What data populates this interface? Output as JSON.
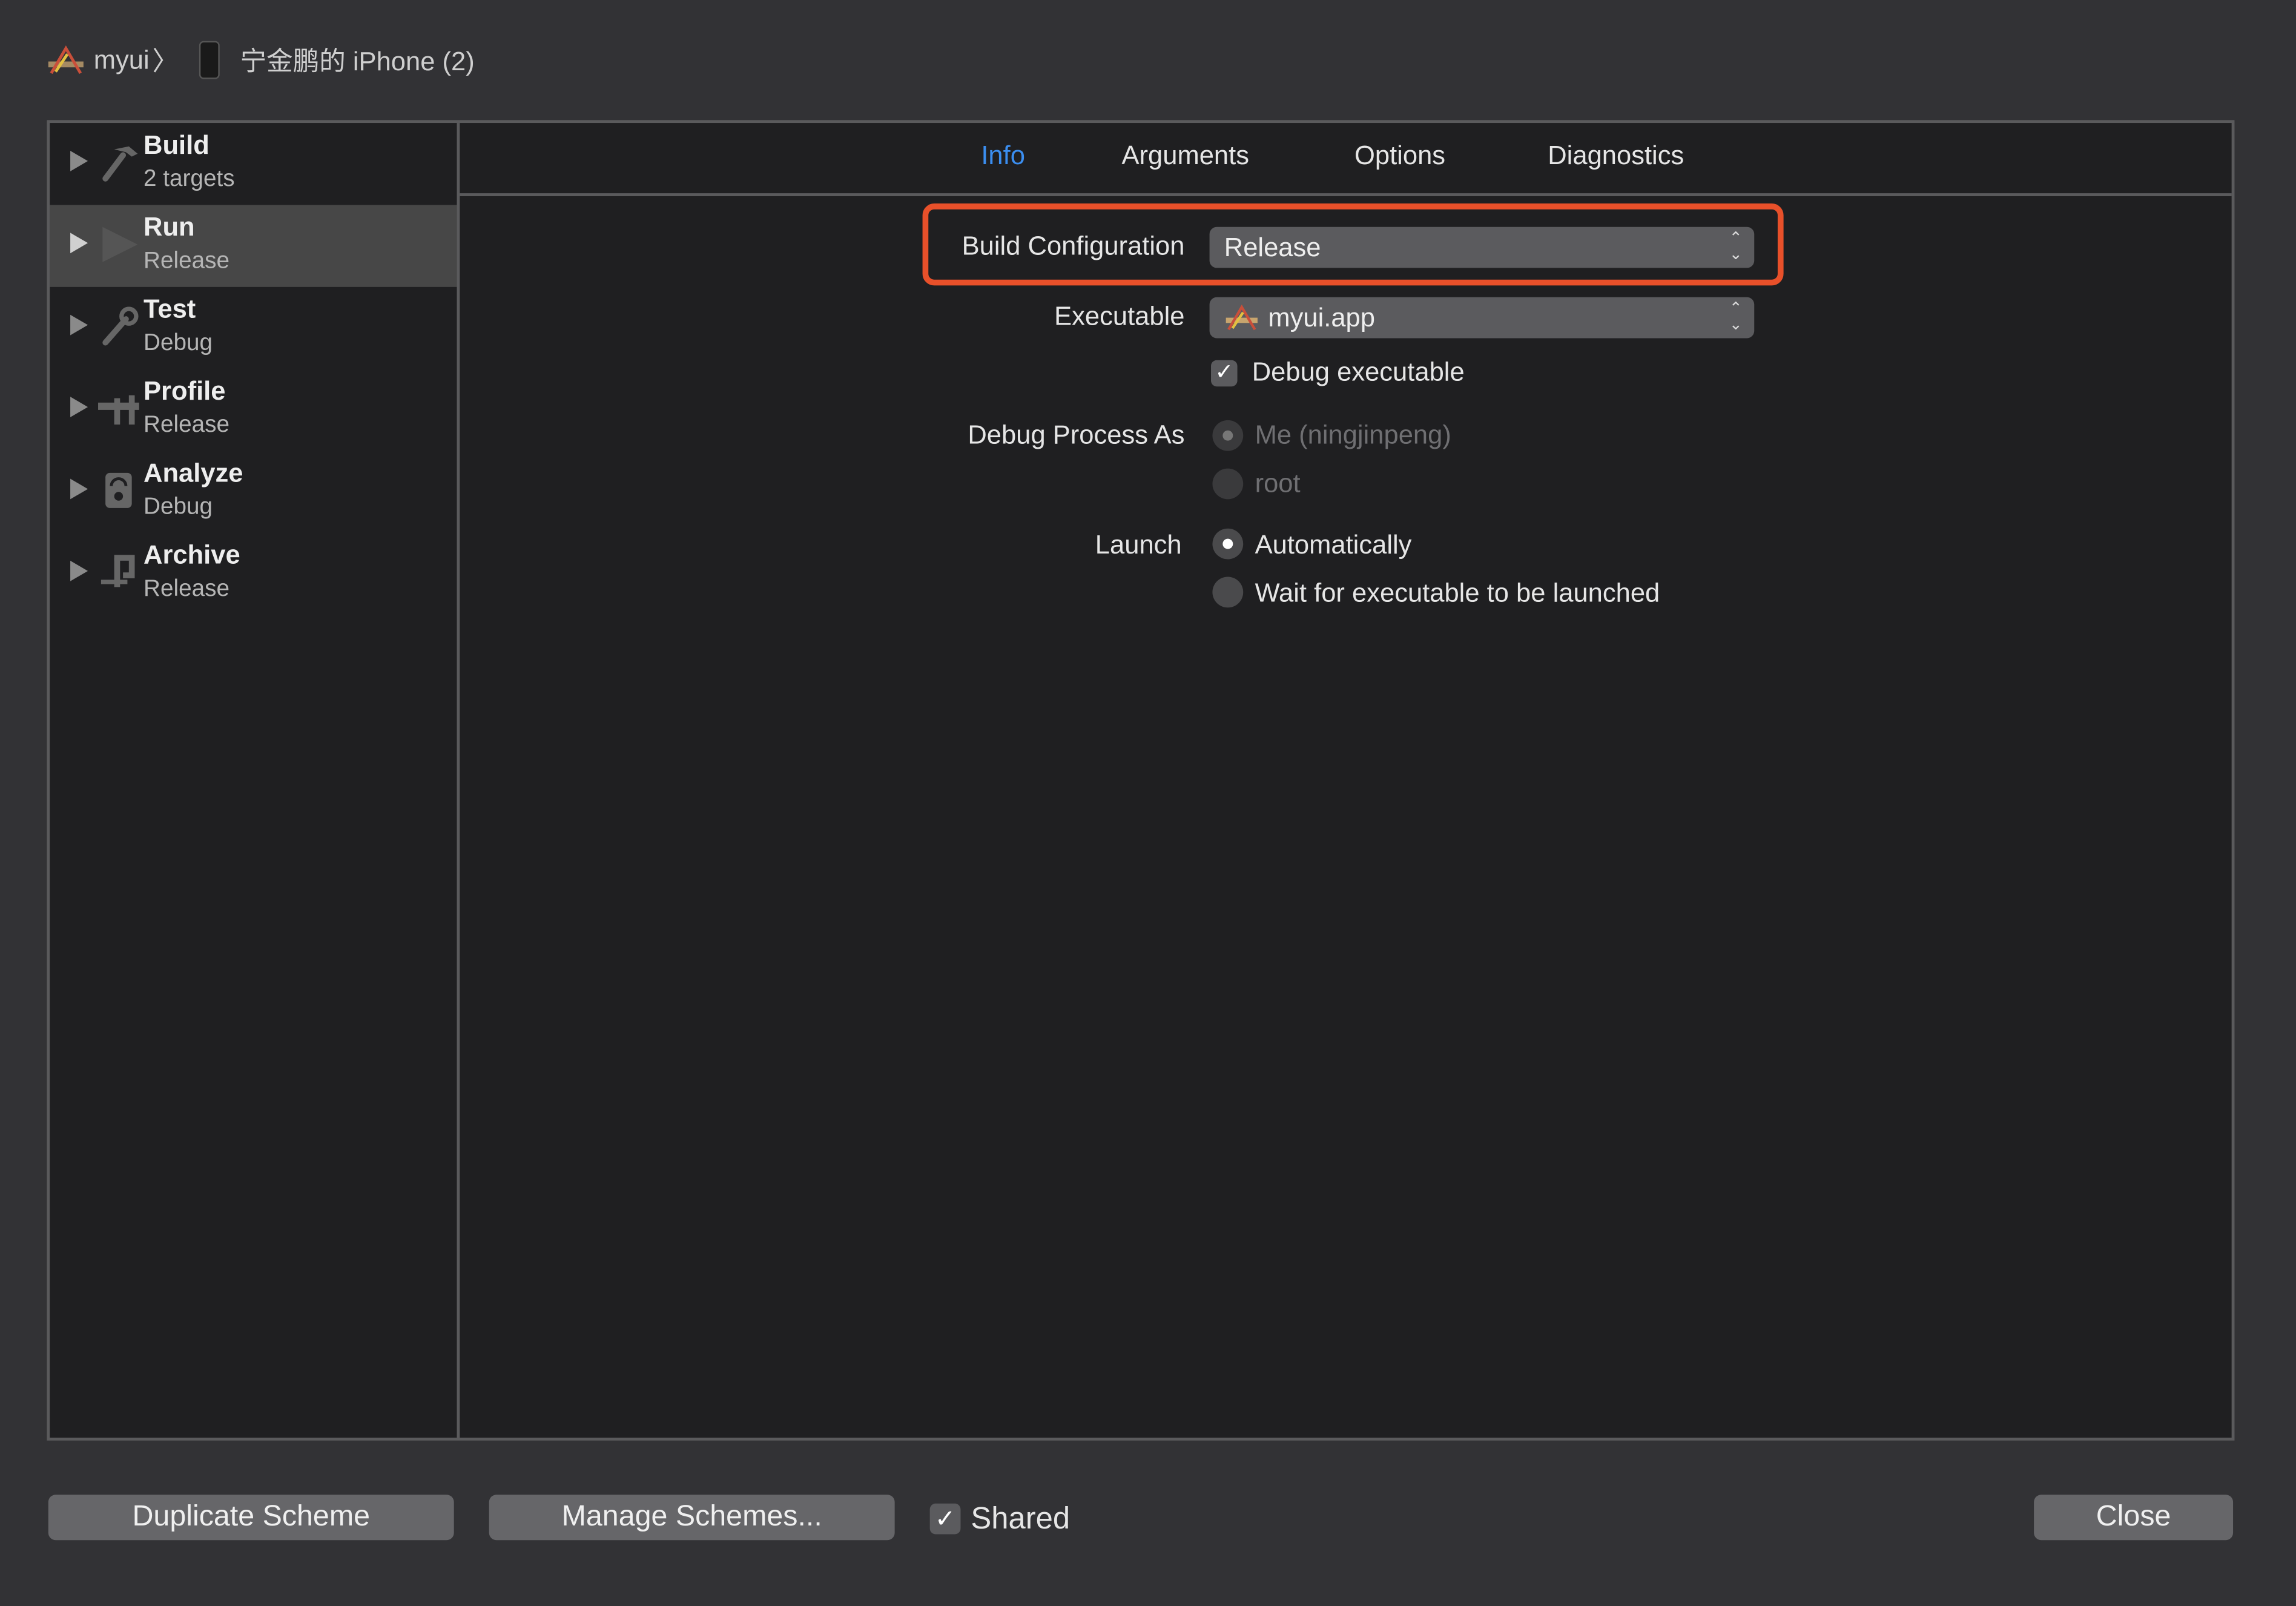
{
  "breadcrumb": {
    "project": "myui",
    "separator": "〉",
    "device": "宁金鹏的 iPhone (2)"
  },
  "sidebar": {
    "items": [
      {
        "title": "Build",
        "subtitle": "2 targets",
        "icon": "hammer-icon",
        "selected": false
      },
      {
        "title": "Run",
        "subtitle": "Release",
        "icon": "play-icon",
        "selected": true
      },
      {
        "title": "Test",
        "subtitle": "Debug",
        "icon": "wrench-icon",
        "selected": false
      },
      {
        "title": "Profile",
        "subtitle": "Release",
        "icon": "caliper-icon",
        "selected": false
      },
      {
        "title": "Analyze",
        "subtitle": "Debug",
        "icon": "gauge-icon",
        "selected": false
      },
      {
        "title": "Archive",
        "subtitle": "Release",
        "icon": "clamp-icon",
        "selected": false
      }
    ]
  },
  "tabs": [
    {
      "label": "Info",
      "active": true
    },
    {
      "label": "Arguments"
    },
    {
      "label": "Options"
    },
    {
      "label": "Diagnostics"
    }
  ],
  "info": {
    "build_config_label": "Build Configuration",
    "build_config_value": "Release",
    "executable_label": "Executable",
    "executable_value": "myui.app",
    "debug_executable_label": "Debug executable",
    "debug_executable_checked": true,
    "debug_process_label": "Debug Process As",
    "process_options": [
      "Me (ningjinpeng)",
      "root"
    ],
    "launch_label": "Launch",
    "launch_options": [
      "Automatically",
      "Wait for executable to be launched"
    ],
    "launch_selected": "Automatically"
  },
  "footer": {
    "duplicate": "Duplicate Scheme",
    "manage": "Manage Schemes...",
    "shared_label": "Shared",
    "shared_checked": true,
    "close": "Close",
    "check": "✓"
  },
  "colors": {
    "accent": "#3b8ef0",
    "highlight": "#e8502a"
  }
}
